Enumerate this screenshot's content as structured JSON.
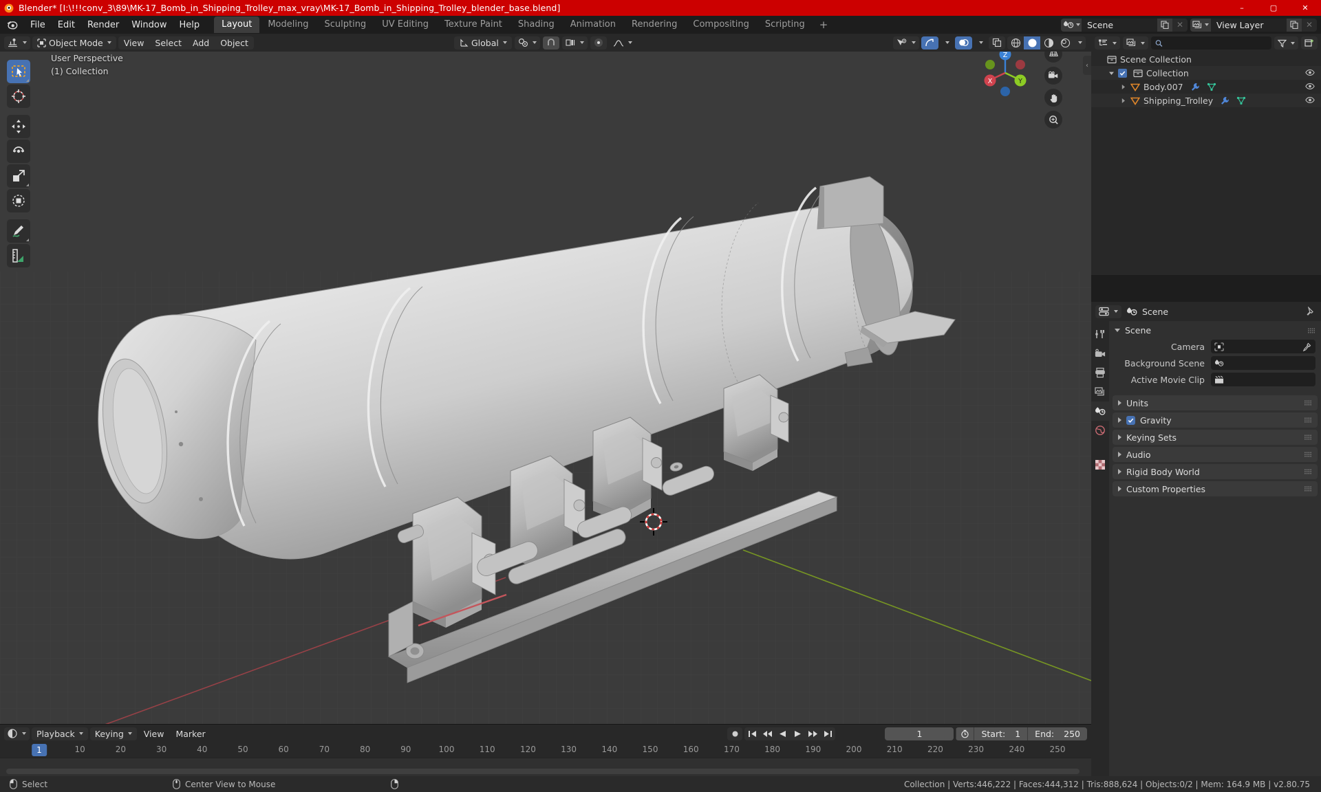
{
  "window": {
    "title": "Blender* [I:\\!!!conv_3\\89\\MK-17_Bomb_in_Shipping_Trolley_max_vray\\MK-17_Bomb_in_Shipping_Trolley_blender_base.blend]",
    "minimize": "–",
    "maximize": "▢",
    "close": "✕",
    "titlebar_color": "#cc0000"
  },
  "menubar": {
    "items": [
      "File",
      "Edit",
      "Render",
      "Window",
      "Help"
    ],
    "workspace_tabs": [
      {
        "label": "Layout",
        "active": true
      },
      {
        "label": "Modeling",
        "active": false
      },
      {
        "label": "Sculpting",
        "active": false
      },
      {
        "label": "UV Editing",
        "active": false
      },
      {
        "label": "Texture Paint",
        "active": false
      },
      {
        "label": "Shading",
        "active": false
      },
      {
        "label": "Animation",
        "active": false
      },
      {
        "label": "Rendering",
        "active": false
      },
      {
        "label": "Compositing",
        "active": false
      },
      {
        "label": "Scripting",
        "active": false
      }
    ],
    "add_workspace_label": "+",
    "scene_id": {
      "name": "Scene",
      "icon": "scene-icon",
      "new_label": "copy-icon",
      "unlink_label": "✕"
    },
    "viewlayer_id": {
      "name": "View Layer",
      "icon": "viewlayer-icon",
      "new_label": "copy-icon",
      "unlink_label": "✕"
    }
  },
  "viewport": {
    "header": {
      "editor_type_icon": "editor-type-3dview-icon",
      "mode": "Object Mode",
      "menus": [
        "View",
        "Select",
        "Add",
        "Object"
      ],
      "transform_orientation": "Global",
      "snap_icon": "magnet-icon",
      "proportional_icon": "proportional-edit-icon",
      "gizmo_icon": "gizmo-icon",
      "overlay_icon": "overlays-icon",
      "xray_icon": "xray-icon",
      "shading_modes": [
        "wireframe",
        "solid",
        "material-preview",
        "rendered"
      ],
      "active_shading": "solid"
    },
    "overlay_text_line1": "User Perspective",
    "overlay_text_line2": "(1) Collection",
    "toolbar": [
      {
        "name": "tweak-select-box-tool",
        "active": true
      },
      {
        "name": "cursor-tool",
        "active": false
      },
      {
        "name": "move-tool",
        "active": false
      },
      {
        "name": "rotate-tool",
        "active": false
      },
      {
        "name": "scale-tool",
        "active": false
      },
      {
        "name": "transform-tool",
        "active": false
      },
      {
        "name": "annotate-tool",
        "active": false
      },
      {
        "name": "measure-tool",
        "active": false
      }
    ],
    "nav_buttons": [
      "toggle-ortho-perspective",
      "toggle-camera-view",
      "pan-view",
      "zoom-view"
    ],
    "gizmo_axes": [
      {
        "label": "Z",
        "color": "#2f86e8"
      },
      {
        "label": "Y",
        "color": "#8dcc24"
      },
      {
        "label": "X",
        "color": "#e8434e"
      }
    ],
    "background_color": "#3b3b3b",
    "grid_color": "#4a4a4a",
    "axis_x_color": "#b74c50",
    "axis_y_color": "#7fa824"
  },
  "outliner": {
    "display_mode_icon": "outliner-display-mode-icon",
    "filter_id_icon": "outliner-viewlayer-icon",
    "search_placeholder": "",
    "search_icon": "search-icon",
    "filter_icon": "filter-icon",
    "new_collection_icon": "new-collection-icon",
    "rows": [
      {
        "label": "Scene Collection",
        "indent": 0,
        "icon": "collection-icon",
        "disclosure": "",
        "checkbox": false,
        "eye": false,
        "modifiers": []
      },
      {
        "label": "Collection",
        "indent": 1,
        "icon": "collection-icon",
        "disclosure": "down",
        "checkbox": true,
        "eye": true,
        "modifiers": []
      },
      {
        "label": "Body.007",
        "indent": 2,
        "icon": "mesh-object-icon",
        "disclosure": "right",
        "checkbox": false,
        "eye": true,
        "modifiers": [
          "modifier-wrench-icon",
          "mesh-data-icon"
        ]
      },
      {
        "label": "Shipping_Trolley",
        "indent": 2,
        "icon": "mesh-object-icon",
        "disclosure": "right",
        "checkbox": false,
        "eye": true,
        "modifiers": [
          "modifier-wrench-icon",
          "mesh-data-icon"
        ]
      }
    ]
  },
  "properties": {
    "editor_icon": "properties-editor-icon",
    "breadcrumb": "Scene",
    "breadcrumb_icon": "scene-properties-icon",
    "pin_icon": "pin-icon",
    "tabs": [
      {
        "name": "tool-tab",
        "icon": "tool-icon",
        "active": false
      },
      {
        "name": "render-tab",
        "icon": "render-camera-icon",
        "active": false
      },
      {
        "name": "output-tab",
        "icon": "printer-icon",
        "active": false
      },
      {
        "name": "viewlayer-tab",
        "icon": "images-icon",
        "active": false
      },
      {
        "name": "scene-tab",
        "icon": "scene-properties-icon",
        "active": true
      },
      {
        "name": "world-tab",
        "icon": "world-globe-icon",
        "active": false
      },
      {
        "name": "texture-tab",
        "icon": "checker-texture-icon",
        "active": false
      }
    ],
    "scene_panel": {
      "title": "Scene",
      "expanded": true,
      "fields": [
        {
          "label": "Camera",
          "value": "",
          "icon": "camera-data-icon",
          "eyedropper": true
        },
        {
          "label": "Background Scene",
          "value": "",
          "icon": "scene-properties-icon",
          "eyedropper": false
        },
        {
          "label": "Active Movie Clip",
          "value": "",
          "icon": "clip-icon",
          "eyedropper": false
        }
      ]
    },
    "panels": [
      {
        "title": "Units",
        "expanded": false,
        "checkbox": null
      },
      {
        "title": "Gravity",
        "expanded": false,
        "checkbox": true
      },
      {
        "title": "Keying Sets",
        "expanded": false,
        "checkbox": null
      },
      {
        "title": "Audio",
        "expanded": false,
        "checkbox": null
      },
      {
        "title": "Rigid Body World",
        "expanded": false,
        "checkbox": null
      },
      {
        "title": "Custom Properties",
        "expanded": false,
        "checkbox": null
      }
    ]
  },
  "timeline": {
    "editor_icon": "timeline-editor-icon",
    "menus": [
      "Playback",
      "Keying",
      "View",
      "Marker"
    ],
    "transport": [
      "record-icon",
      "jump-start-icon",
      "prev-keyframe-icon",
      "play-reverse-icon",
      "play-icon",
      "next-keyframe-icon",
      "jump-end-icon"
    ],
    "current_frame": "1",
    "autokey_icon": "autokey-icon",
    "start_label": "Start:",
    "start_value": "1",
    "end_label": "End:",
    "end_value": "250",
    "ruler_ticks": [
      "10",
      "20",
      "30",
      "40",
      "50",
      "60",
      "70",
      "80",
      "90",
      "100",
      "110",
      "120",
      "130",
      "140",
      "150",
      "160",
      "170",
      "180",
      "190",
      "200",
      "210",
      "220",
      "230",
      "240",
      "250"
    ],
    "playhead_frame": "1"
  },
  "statusbar": {
    "left_items": [
      {
        "icon": "mouse-left-icon",
        "label": "Select"
      },
      {
        "icon": "mouse-middle-icon",
        "label": "Center View to Mouse"
      },
      {
        "icon": "mouse-right-icon",
        "label": ""
      }
    ],
    "stats": "Collection | Verts:446,222 | Faces:444,312 | Tris:888,624 | Objects:0/2 | Mem: 164.9 MB | v2.80.75"
  }
}
